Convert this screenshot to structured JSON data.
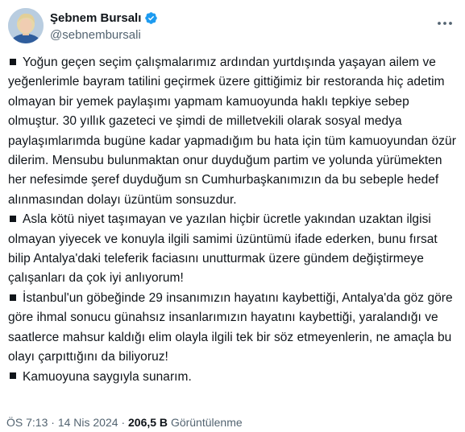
{
  "author": {
    "name": "Şebnem Bursalı",
    "handle": "@sebnembursali",
    "verified": true,
    "verified_color": "#1d9bf0"
  },
  "tweet": {
    "paragraphs": [
      "Yoğun geçen seçim çalışmalarımız ardından yurtdışında yaşayan ailem ve yeğenlerimle bayram tatilini geçirmek üzere gittiğimiz bir restoranda hiç adetim olmayan bir yemek paylaşımı yapmam kamuoyunda haklı tepkiye sebep olmuştur. 30 yıllık gazeteci ve şimdi de milletvekili olarak sosyal medya paylaşımlarımda bugüne kadar yapmadığım bu hata için tüm kamuoyundan özür dilerim. Mensubu bulunmaktan onur duyduğum partim ve yolunda yürümekten her nefesimde şeref duyduğum sn Cumhurbaşkanımızın da bu sebeple hedef alınmasından dolayı üzüntüm sonsuzdur.",
      "Asla kötü niyet taşımayan ve yazılan hiçbir ücretle yakından uzaktan ilgisi olmayan yiyecek ve konuyla ilgili samimi üzüntümü ifade ederken, bunu fırsat bilip Antalya'daki teleferik faciasını unutturmak üzere gündem değiştirmeye çalışanları da çok iyi anlıyorum!",
      "İstanbul'un göbeğinde 29 insanımızın hayatını kaybettiği, Antalya'da göz göre göre ihmal sonucu günahsız insanlarımızın hayatını kaybettiği, yaralandığı ve saatlerce mahsur kaldığı elim olayla ilgili tek bir söz etmeyenlerin, ne amaçla bu olayı çarpıttığını da biliyoruz!",
      "Kamuoyuna saygıyla sunarım."
    ]
  },
  "meta": {
    "time": "ÖS 7:13",
    "separator": "·",
    "date": "14 Nis 2024",
    "views_count": "206,5 B",
    "views_label": "Görüntülenme"
  },
  "icons": {
    "verified": "verified-badge-icon",
    "more": "more-options-icon",
    "bullet": "black-square-icon"
  }
}
